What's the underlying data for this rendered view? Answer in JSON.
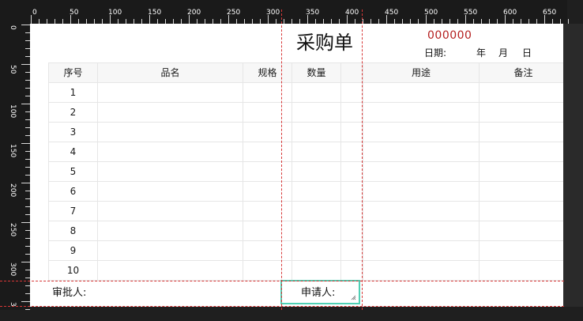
{
  "rulers": {
    "top_labels": [
      "0",
      "50",
      "100",
      "150",
      "200",
      "250",
      "300",
      "350",
      "400",
      "450",
      "500",
      "550",
      "600",
      "650"
    ],
    "left_labels": [
      "0",
      "50",
      "100",
      "150",
      "200",
      "250",
      "300",
      "3"
    ]
  },
  "form": {
    "title": "采购单",
    "serial_number": "000000",
    "date": {
      "label": "日期:",
      "year": "年",
      "month": "月",
      "day": "日"
    },
    "table": {
      "headers": [
        "序号",
        "品名",
        "规格",
        "数量",
        "",
        "用途",
        "备注"
      ],
      "rows": [
        {
          "index": "1"
        },
        {
          "index": "2"
        },
        {
          "index": "3"
        },
        {
          "index": "4"
        },
        {
          "index": "5"
        },
        {
          "index": "6"
        },
        {
          "index": "7"
        },
        {
          "index": "8"
        },
        {
          "index": "9"
        },
        {
          "index": "10"
        }
      ]
    },
    "footer": {
      "approver_label": "审批人:",
      "applicant_label": "申请人:"
    }
  },
  "colors": {
    "serial": "#b41e1e",
    "guide": "#d73737",
    "selection": "#4fd0b5",
    "header_bg": "#f7f7f7"
  }
}
